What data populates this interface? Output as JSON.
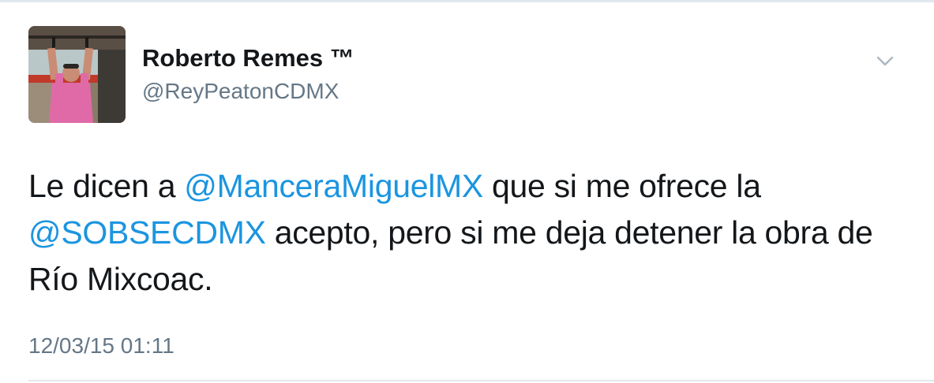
{
  "user": {
    "display_name": "Roberto Remes ™",
    "handle": "@ReyPeatonCDMX"
  },
  "menu": {
    "icon": "chevron-down-icon"
  },
  "tweet": {
    "segments": [
      {
        "type": "text",
        "value": "Le dicen a "
      },
      {
        "type": "mention",
        "value": "@ManceraMiguelMX"
      },
      {
        "type": "text",
        "value": " que si me ofrece la "
      },
      {
        "type": "mention",
        "value": "@SOBSECDMX"
      },
      {
        "type": "text",
        "value": " acepto, pero si me deja detener la obra de Río Mixcoac."
      }
    ],
    "timestamp": "12/03/15 01:11"
  },
  "colors": {
    "mention": "#1b95e0",
    "text": "#14171a",
    "secondary": "#657786",
    "divider": "#e1e8ed"
  }
}
